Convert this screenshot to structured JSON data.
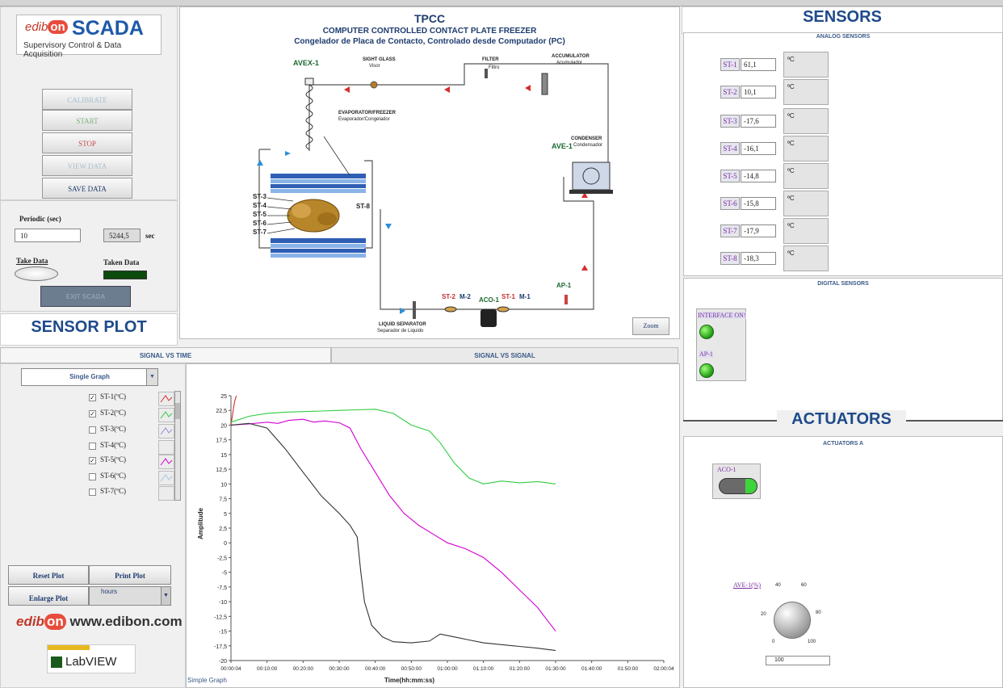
{
  "logo": {
    "brand_prefix": "edib",
    "brand_on": "on",
    "product": "SCADA",
    "subtitle": "Supervisory Control & Data Acquisition"
  },
  "controls": {
    "calibrate": "CALIBRATE",
    "start": "START",
    "stop": "STOP",
    "view_data": "VIEW DATA",
    "save_data": "SAVE DATA",
    "period_label": "Periodic (sec)",
    "period_value": "10",
    "elapsed_value": "5244,5",
    "elapsed_unit": "sec",
    "take_data": "Take Data",
    "taken_data": "Taken Data",
    "exit": "EXIT SCADA"
  },
  "sections": {
    "sensor_plot": "SENSOR PLOT",
    "sensors": "SENSORS",
    "actuators": "ACTUATORS"
  },
  "diagram": {
    "code": "TPCC",
    "title_en": "COMPUTER CONTROLLED CONTACT PLATE FREEZER",
    "title_es": "Congelador de Placa de Contacto, Controlado desde Computador (PC)",
    "labels": {
      "avex": "AVEX-1",
      "sight_glass": "SIGHT GLASS",
      "sight_glass_es": "Visor",
      "filter": "FILTER",
      "filter_es": "Filtro",
      "accumulator": "ACCUMULATOR",
      "accumulator_es": "Acumulador",
      "evaporator": "EVAPORATOR/FREEZER",
      "evaporator_es": "Evaporador/Congelador",
      "condenser": "CONDENSER",
      "condenser_es": "Condensador",
      "ave": "AVE-1",
      "st3": "ST-3",
      "st4": "ST-4",
      "st5": "ST-5",
      "st6": "ST-6",
      "st7": "ST-7",
      "st8": "ST-8",
      "st2": "ST-2",
      "m2": "M-2",
      "aco": "ACO-1",
      "st1": "ST-1",
      "m1": "M-1",
      "ap1": "AP-1",
      "liquid_sep": "LIQUID SEPARATOR",
      "liquid_sep_es": "Separador de Liquido"
    },
    "zoom": "Zoom"
  },
  "sensors": {
    "analog_title": "ANALOG SENSORS",
    "digital_title": "DIGITAL SENSORS",
    "unit": "ºC",
    "analog": [
      {
        "name": "ST-1",
        "value": "61,1"
      },
      {
        "name": "ST-2",
        "value": "10,1"
      },
      {
        "name": "ST-3",
        "value": "-17,6"
      },
      {
        "name": "ST-4",
        "value": "-16,1"
      },
      {
        "name": "ST-5",
        "value": "-14,8"
      },
      {
        "name": "ST-6",
        "value": "-15,8"
      },
      {
        "name": "ST-7",
        "value": "-17,9"
      },
      {
        "name": "ST-8",
        "value": "-18,3"
      }
    ],
    "digital": [
      {
        "name": "INTERFACE ON!"
      },
      {
        "name": "AP-1"
      }
    ]
  },
  "actuators": {
    "panel_title": "ACTUATORS A",
    "aco_label": "ACO-1",
    "ave_label": "AVE-1(%)",
    "ave_value": "100",
    "knob_ticks": [
      "0",
      "20",
      "40",
      "60",
      "80",
      "100"
    ]
  },
  "plot": {
    "tab_time": "SIGNAL VS TIME",
    "tab_signal": "SIGNAL VS SIGNAL",
    "mode": "Single Graph",
    "time_unit": "hours",
    "reset": "Reset Plot",
    "print": "Print Plot",
    "enlarge": "Enlarge Plot",
    "footer_label": "Simple Graph",
    "channels": [
      {
        "name": "ST-1(ºC)",
        "checked": true,
        "color": "#d32f2f"
      },
      {
        "name": "ST-2(ºC)",
        "checked": true,
        "color": "#2ecc40"
      },
      {
        "name": "ST-3(ºC)",
        "checked": false,
        "color": "#8e8ed8"
      },
      {
        "name": "ST-4(ºC)",
        "checked": false,
        "color": "#cccccc"
      },
      {
        "name": "ST-5(ºC)",
        "checked": true,
        "color": "#d400d4"
      },
      {
        "name": "ST-6(ºC)",
        "checked": false,
        "color": "#9ec8e0"
      },
      {
        "name": "ST-7(ºC)",
        "checked": false,
        "color": "#cccccc"
      }
    ]
  },
  "website": "www.edibon.com",
  "labview": "LabVIEW",
  "chart_data": {
    "type": "line",
    "xlabel": "Time(hh:mm:ss)",
    "ylabel": "Amplitude",
    "xlim": [
      0,
      120
    ],
    "ylim": [
      -20,
      25
    ],
    "x_ticks": [
      "00:00:04",
      "00:10:00",
      "00:20:00",
      "00:30:00",
      "00:40:00",
      "00:50:00",
      "01:00:00",
      "01:10:00",
      "01:20:00",
      "01:30:00",
      "01:40:00",
      "01:50:00",
      "02:00:04"
    ],
    "y_ticks": [
      25,
      22.5,
      20,
      17.5,
      15,
      12.5,
      10,
      7.5,
      5,
      2.5,
      0,
      -2.5,
      -5,
      -7.5,
      -10,
      -12.5,
      -15,
      -17.5,
      -20
    ],
    "series": [
      {
        "color": "#d32f2f",
        "points": [
          [
            0,
            20
          ],
          [
            0.5,
            22
          ],
          [
            1,
            24
          ],
          [
            1.5,
            25
          ]
        ]
      },
      {
        "color": "#2ecc40",
        "points": [
          [
            0,
            20.5
          ],
          [
            5,
            21.5
          ],
          [
            10,
            22
          ],
          [
            15,
            22.2
          ],
          [
            20,
            22.3
          ],
          [
            25,
            22.4
          ],
          [
            30,
            22.5
          ],
          [
            35,
            22.6
          ],
          [
            40,
            22.7
          ],
          [
            45,
            22
          ],
          [
            50,
            20
          ],
          [
            55,
            19
          ],
          [
            58,
            17
          ],
          [
            62,
            13.5
          ],
          [
            66,
            11
          ],
          [
            70,
            10
          ],
          [
            75,
            10.5
          ],
          [
            80,
            10.2
          ],
          [
            85,
            10.4
          ],
          [
            90,
            10
          ]
        ]
      },
      {
        "color": "#d400d4",
        "points": [
          [
            0,
            20
          ],
          [
            5,
            20.2
          ],
          [
            10,
            20.5
          ],
          [
            13,
            20.3
          ],
          [
            16,
            20.8
          ],
          [
            20,
            21
          ],
          [
            23,
            20.5
          ],
          [
            26,
            20.7
          ],
          [
            30,
            20.4
          ],
          [
            33,
            19.5
          ],
          [
            36,
            16
          ],
          [
            40,
            12
          ],
          [
            44,
            8
          ],
          [
            48,
            5
          ],
          [
            52,
            3
          ],
          [
            56,
            1.5
          ],
          [
            60,
            0
          ],
          [
            65,
            -1
          ],
          [
            70,
            -2.5
          ],
          [
            75,
            -5
          ],
          [
            80,
            -8
          ],
          [
            85,
            -11
          ],
          [
            90,
            -15
          ]
        ]
      },
      {
        "color": "#333333",
        "points": [
          [
            0,
            20
          ],
          [
            5,
            20.3
          ],
          [
            10,
            19.5
          ],
          [
            15,
            16
          ],
          [
            20,
            12
          ],
          [
            25,
            8
          ],
          [
            30,
            5
          ],
          [
            33,
            3
          ],
          [
            35,
            1
          ],
          [
            36,
            -5
          ],
          [
            37,
            -10
          ],
          [
            39,
            -14
          ],
          [
            42,
            -16
          ],
          [
            45,
            -16.8
          ],
          [
            50,
            -17
          ],
          [
            55,
            -16.7
          ],
          [
            58,
            -15.5
          ],
          [
            62,
            -16
          ],
          [
            66,
            -16.5
          ],
          [
            70,
            -17
          ],
          [
            75,
            -17.3
          ],
          [
            80,
            -17.6
          ],
          [
            85,
            -17.9
          ],
          [
            90,
            -18.3
          ]
        ]
      }
    ]
  }
}
